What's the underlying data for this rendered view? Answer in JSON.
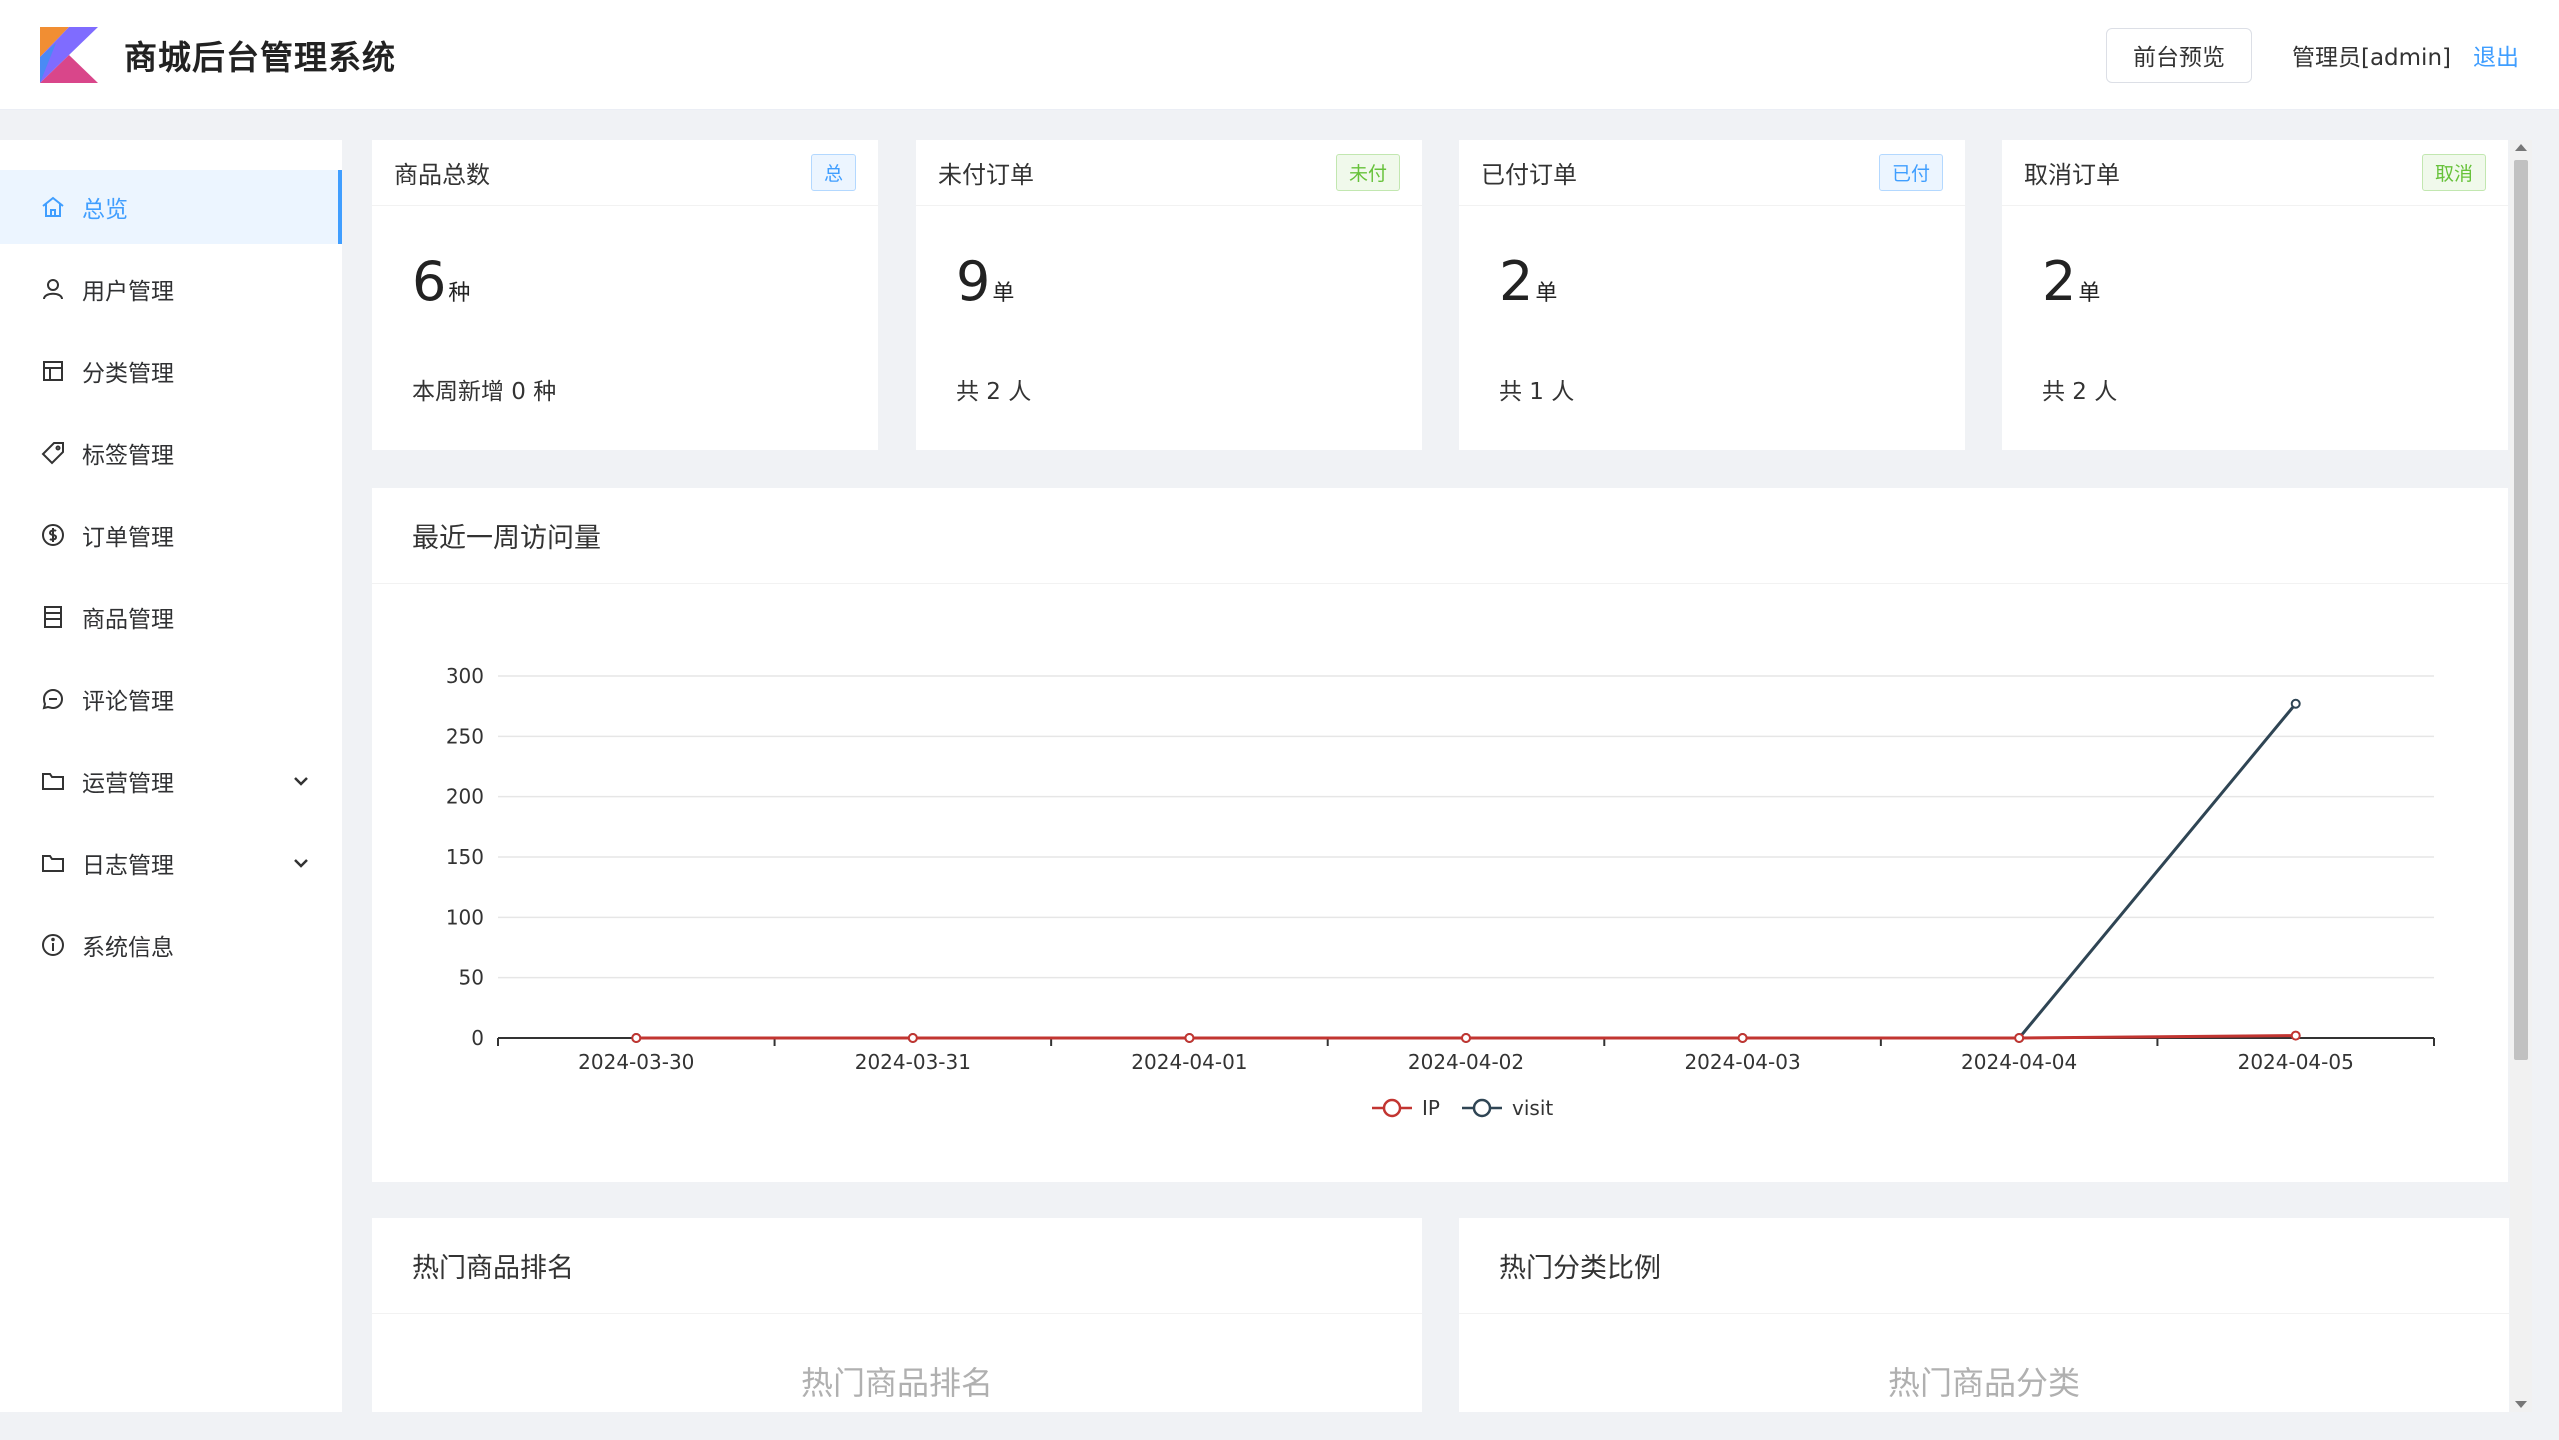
{
  "header": {
    "title": "商城后台管理系统",
    "preview_button": "前台预览",
    "admin_label": "管理员[admin]",
    "logout": "退出"
  },
  "sidebar": {
    "items": [
      {
        "label": "总览",
        "icon": "home-icon",
        "active": true
      },
      {
        "label": "用户管理",
        "icon": "user-icon"
      },
      {
        "label": "分类管理",
        "icon": "layout-icon"
      },
      {
        "label": "标签管理",
        "icon": "tag-icon"
      },
      {
        "label": "订单管理",
        "icon": "coin-icon"
      },
      {
        "label": "商品管理",
        "icon": "list-icon"
      },
      {
        "label": "评论管理",
        "icon": "chat-icon"
      },
      {
        "label": "运营管理",
        "icon": "folder-icon",
        "expandable": true
      },
      {
        "label": "日志管理",
        "icon": "folder-icon",
        "expandable": true
      },
      {
        "label": "系统信息",
        "icon": "info-icon"
      }
    ]
  },
  "stats": [
    {
      "title": "商品总数",
      "tag": "总",
      "value": "6",
      "unit": "种",
      "sub": "本周新增 0 种"
    },
    {
      "title": "未付订单",
      "tag": "未付",
      "value": "9",
      "unit": "单",
      "sub": "共 2 人"
    },
    {
      "title": "已付订单",
      "tag": "已付",
      "value": "2",
      "unit": "单",
      "sub": "共 1 人"
    },
    {
      "title": "取消订单",
      "tag": "取消",
      "value": "2",
      "unit": "单",
      "sub": "共 2 人"
    }
  ],
  "visits": {
    "title": "最近一周访问量"
  },
  "hot_products": {
    "title": "热门商品排名",
    "placeholder": "热门商品排名"
  },
  "hot_categories": {
    "title": "热门分类比例",
    "placeholder": "热门商品分类"
  },
  "colors": {
    "accent": "#409eff",
    "ip_series": "#c23531",
    "visit_series": "#2f4554"
  },
  "chart_data": {
    "type": "line",
    "categories": [
      "2024-03-30",
      "2024-03-31",
      "2024-04-01",
      "2024-04-02",
      "2024-04-03",
      "2024-04-04",
      "2024-04-05"
    ],
    "series": [
      {
        "name": "IP",
        "values": [
          0,
          0,
          0,
          0,
          0,
          0,
          2
        ]
      },
      {
        "name": "visit",
        "values": [
          0,
          0,
          0,
          0,
          0,
          0,
          277
        ]
      }
    ],
    "yticks": [
      0,
      50,
      100,
      150,
      200,
      250,
      300
    ],
    "ylim": [
      0,
      300
    ],
    "grid": true,
    "legend": "bottom-center"
  }
}
